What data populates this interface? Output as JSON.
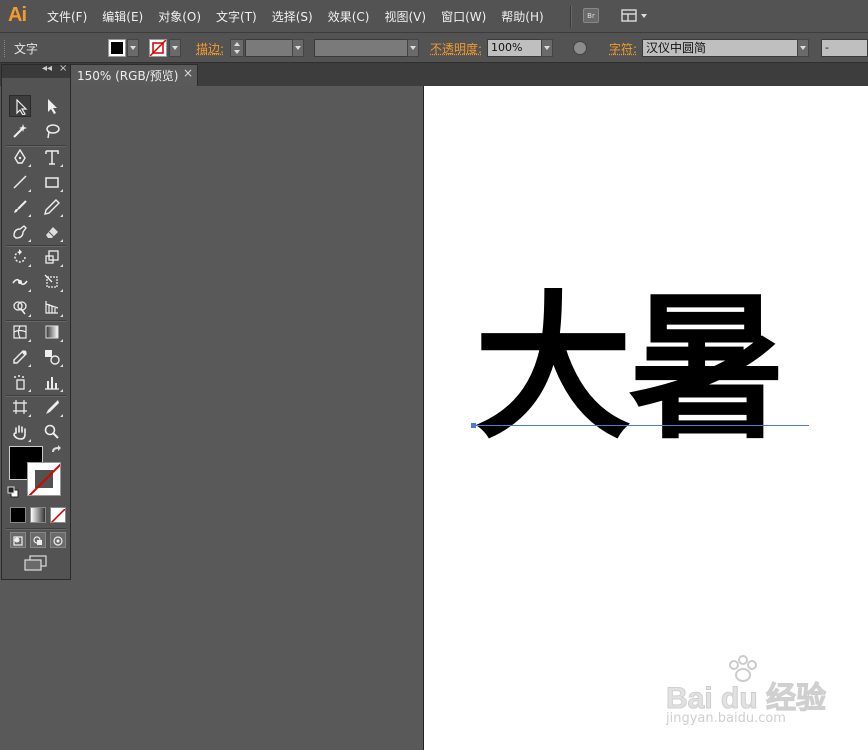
{
  "app": {
    "logo": "Ai",
    "menu": [
      "文件(F)",
      "编辑(E)",
      "对象(O)",
      "文字(T)",
      "选择(S)",
      "效果(C)",
      "视图(V)",
      "窗口(W)",
      "帮助(H)"
    ],
    "bridge_button": "Br"
  },
  "control_bar": {
    "selection_label": "文字",
    "stroke_label": "描边:",
    "opacity_label": "不透明度:",
    "opacity_value": "100%",
    "character_label": "字符:",
    "font_family": "汉仪中圆简",
    "font_style": "-"
  },
  "document": {
    "tab_label": "150% (RGB/预览)",
    "close_glyph": "×"
  },
  "canvas": {
    "text": "大暑"
  },
  "tools_panel": {
    "collapse_glyph": "◂◂",
    "close_glyph": "×",
    "fill_color": "#000000",
    "stroke_color": "none"
  },
  "watermark": {
    "brand": "Bai du 经验",
    "site": "jingyan.baidu.com"
  },
  "colors": {
    "accent": "#f39a2d",
    "ui_bg": "#535353",
    "selection_blue": "#4b7bd8"
  }
}
